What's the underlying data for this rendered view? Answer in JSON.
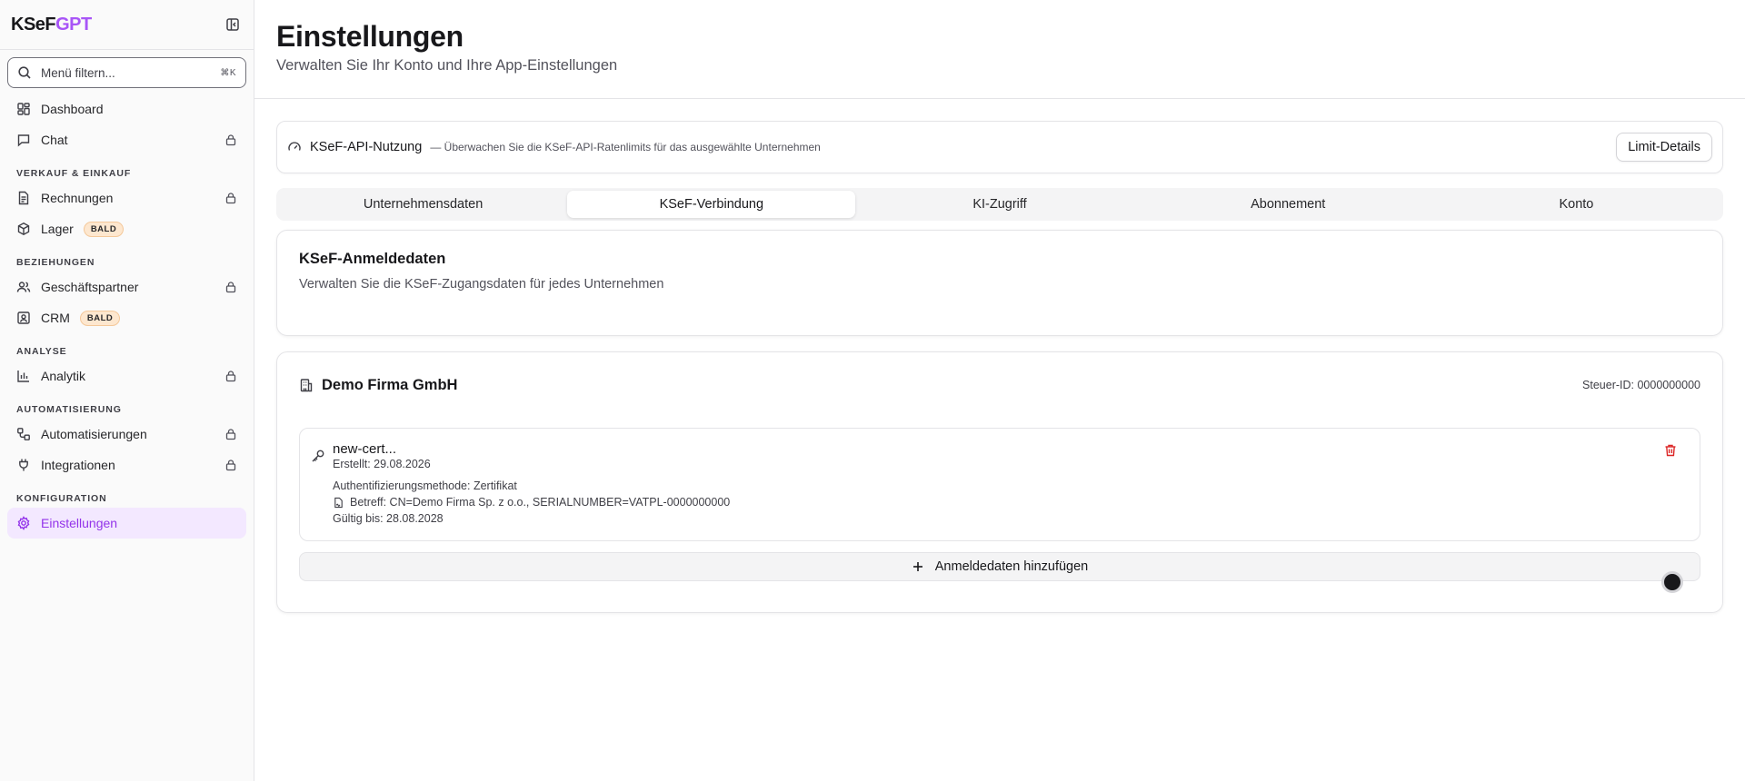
{
  "brand": {
    "part1": "KSeF",
    "part2": "GPT"
  },
  "sidebar": {
    "search_placeholder": "Menü filtern...",
    "search_shortcut": "⌘K",
    "items": [
      {
        "label": "Dashboard",
        "icon": "dashboard-icon"
      },
      {
        "label": "Chat",
        "icon": "chat-icon",
        "locked": true
      }
    ],
    "sections": [
      {
        "title": "VERKAUF & EINKAUF",
        "items": [
          {
            "label": "Rechnungen",
            "locked": true
          },
          {
            "label": "Lager",
            "badge": "BALD"
          }
        ]
      },
      {
        "title": "BEZIEHUNGEN",
        "items": [
          {
            "label": "Geschäftspartner",
            "locked": true
          },
          {
            "label": "CRM",
            "badge": "BALD"
          }
        ]
      },
      {
        "title": "ANALYSE",
        "items": [
          {
            "label": "Analytik",
            "locked": true
          }
        ]
      },
      {
        "title": "AUTOMATISIERUNG",
        "items": [
          {
            "label": "Automatisierungen",
            "locked": true
          },
          {
            "label": "Integrationen",
            "locked": true
          }
        ]
      },
      {
        "title": "KONFIGURATION",
        "items": [
          {
            "label": "Einstellungen",
            "active": true
          }
        ]
      }
    ]
  },
  "header": {
    "title": "Einstellungen",
    "subtitle": "Verwalten Sie Ihr Konto und Ihre App-Einstellungen"
  },
  "api_usage": {
    "title": "KSeF-API-Nutzung",
    "description": "— Überwachen Sie die KSeF-API-Ratenlimits für das ausgewählte Unternehmen",
    "button": "Limit-Details"
  },
  "tabs": [
    {
      "label": "Unternehmensdaten"
    },
    {
      "label": "KSeF-Verbindung",
      "active": true
    },
    {
      "label": "KI-Zugriff"
    },
    {
      "label": "Abonnement"
    },
    {
      "label": "Konto"
    }
  ],
  "credentials": {
    "title": "KSeF-Anmeldedaten",
    "description": "Verwalten Sie die KSeF-Zugangsdaten für jedes Unternehmen"
  },
  "company": {
    "name": "Demo Firma GmbH",
    "tax_id": "Steuer-ID: 0000000000",
    "certificate": {
      "name": "new-cert...",
      "created": "Erstellt: 29.08.2026",
      "auth_method": "Authentifizierungsmethode:  Zertifikat",
      "subject": "Betreff: CN=Demo Firma Sp. z o.o., SERIALNUMBER=VATPL-0000000000",
      "valid_until": "Gültig bis: 28.08.2028"
    },
    "add_button": "Anmeldedaten hinzufügen"
  },
  "colors": {
    "accent": "#a855f7",
    "active_bg": "#f3e8ff",
    "danger": "#dc2626",
    "badge_bg": "#fde7cf"
  }
}
